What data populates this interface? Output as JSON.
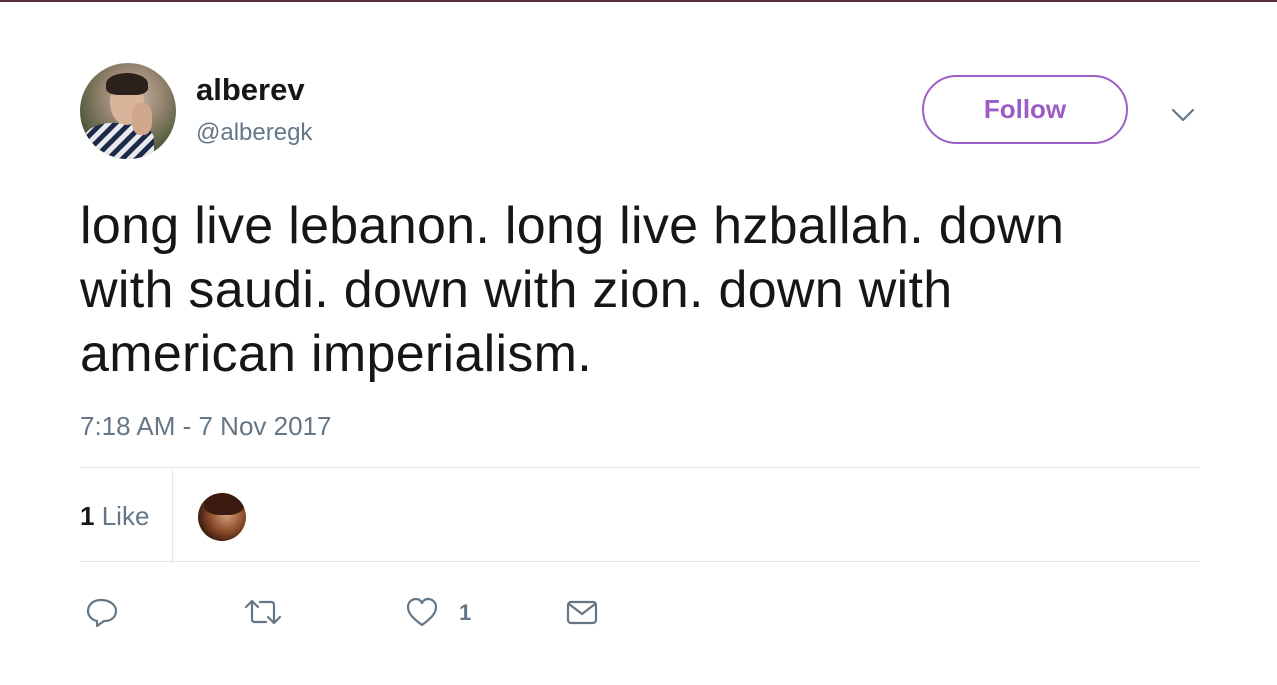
{
  "user": {
    "display_name": "alberev",
    "handle": "@alberegk"
  },
  "follow_button": {
    "label": "Follow",
    "accent_color": "#9b5cc6"
  },
  "tweet": {
    "text": "long live lebanon. long live hzballah. down with saudi. down with zion. down with american imperialism.",
    "timestamp": "7:18 AM - 7 Nov 2017"
  },
  "stats": {
    "likes_count": "1",
    "likes_label": "Like"
  },
  "actions": {
    "reply_icon": "reply-icon",
    "retweet_icon": "retweet-icon",
    "like_icon": "heart-icon",
    "like_count": "1",
    "dm_icon": "envelope-icon"
  },
  "colors": {
    "text_primary": "#14171a",
    "text_secondary": "#657786",
    "divider": "#e1e8ed"
  }
}
